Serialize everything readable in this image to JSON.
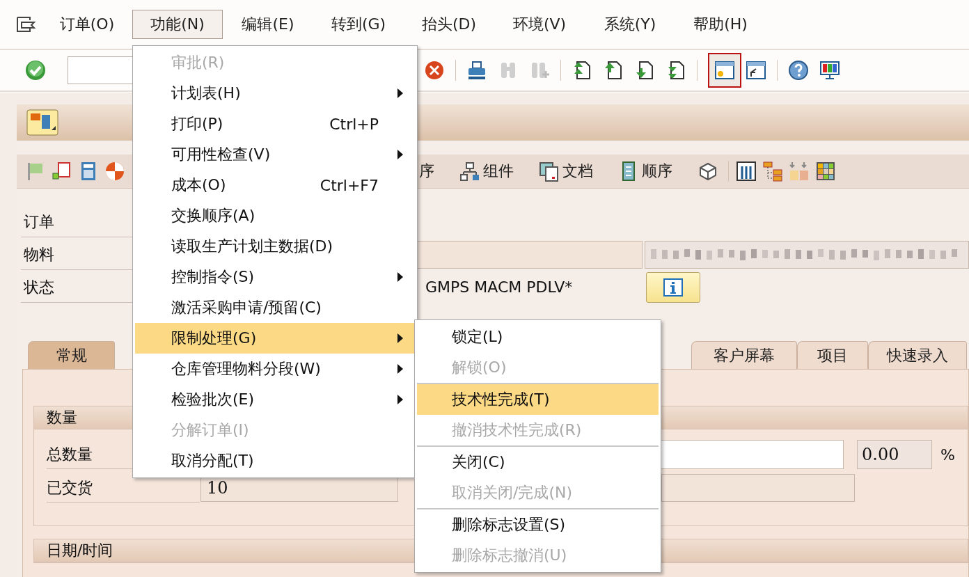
{
  "menu_bar": [
    {
      "label": "订单(O)",
      "selected": false
    },
    {
      "label": "功能(N)",
      "selected": true
    },
    {
      "label": "编辑(E)",
      "selected": false
    },
    {
      "label": "转到(G)",
      "selected": false
    },
    {
      "label": "抬头(D)",
      "selected": false
    },
    {
      "label": "环境(V)",
      "selected": false
    },
    {
      "label": "系统(Y)",
      "selected": false
    },
    {
      "label": "帮助(H)",
      "selected": false
    }
  ],
  "app_toolbar": [
    {
      "label": "序",
      "kind": "text"
    },
    {
      "label": "组件",
      "kind": "components"
    },
    {
      "label": "文档",
      "kind": "document"
    },
    {
      "label": "顺序",
      "kind": "sequence"
    }
  ],
  "header_fields": [
    {
      "label": "订单"
    },
    {
      "label": "物料",
      "kind": "material"
    },
    {
      "label": "状态",
      "kind": "status",
      "value": "GMPS MACM PDLV*"
    }
  ],
  "tabs": [
    {
      "label": "常规",
      "selected": true
    },
    {
      "label": "客户屏幕",
      "selected": false
    },
    {
      "label": "项目",
      "selected": false
    },
    {
      "label": "快速录入",
      "selected": false
    }
  ],
  "quantity_group": {
    "title": "数量",
    "rows": [
      {
        "label": "总数量",
        "percent": "0.00",
        "unit": "%"
      },
      {
        "label": "已交货",
        "value": "10"
      }
    ]
  },
  "date_group": {
    "title": "日期/时间"
  },
  "function_menu": [
    {
      "label": "审批(R)",
      "disabled": true,
      "submenu": false,
      "selected": false
    },
    {
      "label": "计划表(H)",
      "disabled": false,
      "submenu": true,
      "selected": false
    },
    {
      "label": "打印(P)",
      "disabled": false,
      "submenu": false,
      "selected": false,
      "shortcut": "Ctrl+P"
    },
    {
      "label": "可用性检查(V)",
      "disabled": false,
      "submenu": true,
      "selected": false
    },
    {
      "label": "成本(O)",
      "disabled": false,
      "submenu": false,
      "selected": false,
      "shortcut": "Ctrl+F7"
    },
    {
      "label": "交换顺序(A)",
      "disabled": false,
      "submenu": false,
      "selected": false
    },
    {
      "label": "读取生产计划主数据(D)",
      "disabled": false,
      "submenu": false,
      "selected": false
    },
    {
      "label": "控制指令(S)",
      "disabled": false,
      "submenu": true,
      "selected": false
    },
    {
      "label": "激活采购申请/预留(C)",
      "disabled": false,
      "submenu": false,
      "selected": false
    },
    {
      "label": "限制处理(G)",
      "disabled": false,
      "submenu": true,
      "selected": true
    },
    {
      "label": "仓库管理物料分段(W)",
      "disabled": false,
      "submenu": true,
      "selected": false
    },
    {
      "label": "检验批次(E)",
      "disabled": false,
      "submenu": true,
      "selected": false
    },
    {
      "label": "分解订单(I)",
      "disabled": true,
      "submenu": false,
      "selected": false
    },
    {
      "label": "取消分配(T)",
      "disabled": false,
      "submenu": false,
      "selected": false
    }
  ],
  "restriction_submenu": [
    {
      "label": "锁定(L)",
      "disabled": false,
      "selected": false,
      "divider_above": false
    },
    {
      "label": "解锁(O)",
      "disabled": true,
      "selected": false,
      "divider_above": false
    },
    {
      "label": "技术性完成(T)",
      "disabled": false,
      "selected": true,
      "divider_above": true
    },
    {
      "label": "撤消技术性完成(R)",
      "disabled": true,
      "selected": false,
      "divider_above": false
    },
    {
      "label": "关闭(C)",
      "disabled": false,
      "selected": false,
      "divider_above": true
    },
    {
      "label": "取消关闭/完成(N)",
      "disabled": true,
      "selected": false,
      "divider_above": false
    },
    {
      "label": "删除标志设置(S)",
      "disabled": false,
      "selected": false,
      "divider_above": true
    },
    {
      "label": "删除标志撤消(U)",
      "disabled": true,
      "selected": false,
      "divider_above": false
    }
  ]
}
